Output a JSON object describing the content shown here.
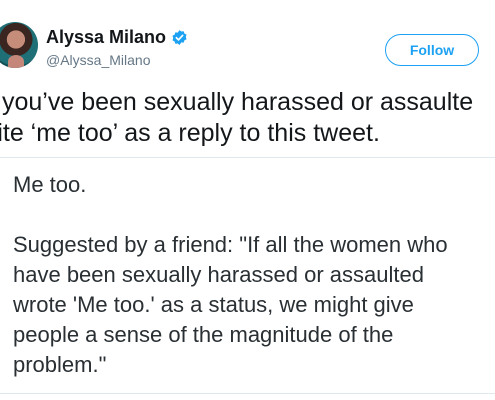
{
  "author": {
    "name": "Alyssa Milano",
    "handle": "@Alyssa_Milano",
    "avatar_icon": "profile-photo",
    "verified_icon": "verified-badge-icon",
    "verified_color": "#1da1f2"
  },
  "follow_button": {
    "label": "Follow",
    "color": "#1da1f2"
  },
  "tweet": {
    "lines": [
      "you’ve been sexually harassed or assaulte",
      "rite ‘me too’ as a reply to this tweet."
    ]
  },
  "quoted_text": {
    "lines": [
      "Me too.",
      "Suggested by a friend: \"If all the women who",
      "have been sexually harassed or assaulted",
      "wrote 'Me too.' as a status, we might give",
      "people a sense of the magnitude of the",
      "problem.\""
    ]
  }
}
